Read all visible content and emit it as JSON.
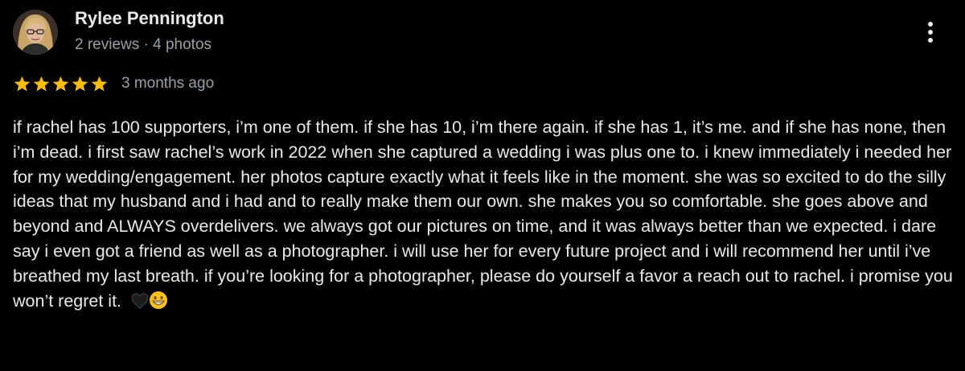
{
  "reviewer": {
    "name": "Rylee Pennington",
    "meta": "2 reviews · 4 photos"
  },
  "rating": {
    "stars": 5,
    "max_stars": 5,
    "star_color": "#fbbc04",
    "date": "3 months ago"
  },
  "review": {
    "text": "if rachel has 100 supporters, i’m one of them. if she has 10, i’m there again. if she has 1, it’s me. and if she has none, then i’m dead. i first saw rachel’s work in 2022 when she captured a wedding i was plus one to. i knew immediately i needed her for my wedding/engagement. her photos capture exactly what it feels like in the moment. she was so excited to do the silly ideas that my husband and i had and to really make them our own. she makes you so comfortable. she goes above and beyond and ALWAYS overdelivers. we always got our pictures on time, and it was always better than we expected. i dare say i even got a friend as well as a photographer. i will use her for every future project and i will recommend her until i’ve breathed my last breath. if you’re looking for a photographer, please do yourself a favor a reach out to rachel. i promise you won’t regret it.",
    "emojis": [
      "black-heart-emoji",
      "grinning-face-emoji"
    ]
  },
  "icons": {
    "menu": "more-vertical-icon",
    "star": "star-icon"
  },
  "colors": {
    "background": "#000000",
    "primary_text": "#e8eaed",
    "secondary_text": "#9aa0a6",
    "star": "#fbbc04"
  }
}
